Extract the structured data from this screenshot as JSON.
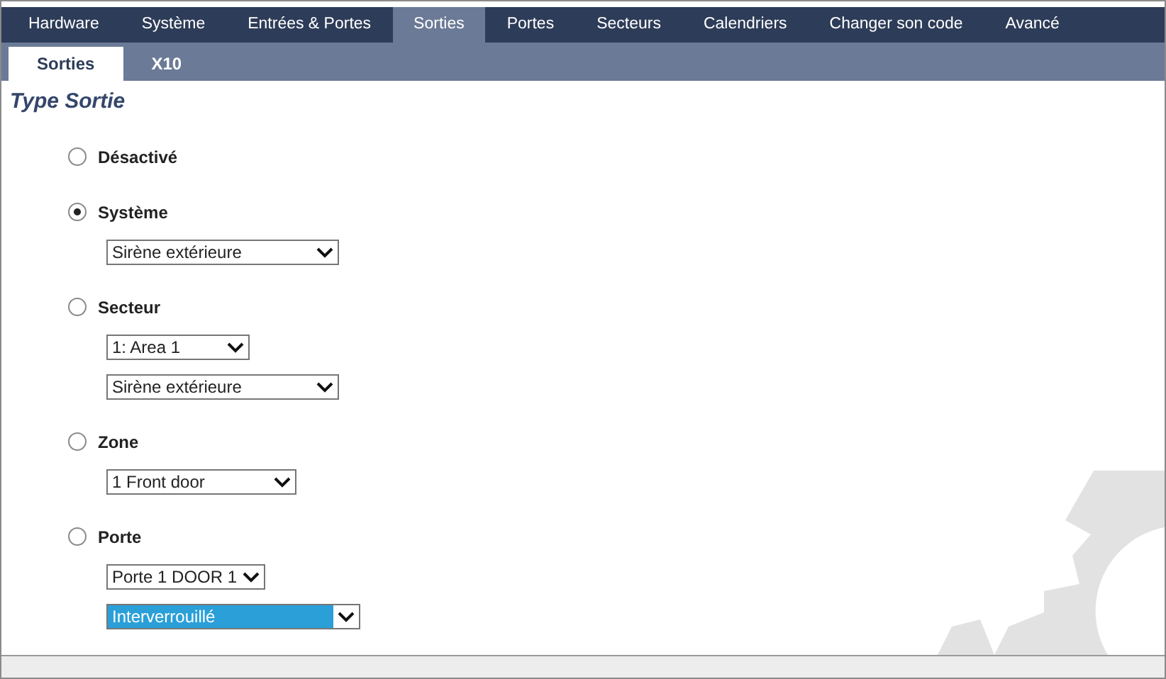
{
  "main_tabs": [
    {
      "label": "Hardware",
      "selected": false
    },
    {
      "label": "Système",
      "selected": false
    },
    {
      "label": "Entrées & Portes",
      "selected": false
    },
    {
      "label": "Sorties",
      "selected": true
    },
    {
      "label": "Portes",
      "selected": false
    },
    {
      "label": "Secteurs",
      "selected": false
    },
    {
      "label": "Calendriers",
      "selected": false
    },
    {
      "label": "Changer son code",
      "selected": false
    },
    {
      "label": "Avancé",
      "selected": false
    }
  ],
  "sub_tabs": [
    {
      "label": "Sorties",
      "selected": true
    },
    {
      "label": "X10",
      "selected": false
    }
  ],
  "section_title": "Type Sortie",
  "options": [
    {
      "label": "Désactivé",
      "selected": false
    },
    {
      "label": "Système",
      "selected": true,
      "dropdowns": [
        {
          "value": "Sirène extérieure",
          "highlighted": false
        }
      ]
    },
    {
      "label": "Secteur",
      "selected": false,
      "dropdowns": [
        {
          "value": "1: Area 1",
          "highlighted": false
        },
        {
          "value": "Sirène extérieure",
          "highlighted": false
        }
      ]
    },
    {
      "label": "Zone",
      "selected": false,
      "dropdowns": [
        {
          "value": "1 Front door",
          "highlighted": false
        }
      ]
    },
    {
      "label": "Porte",
      "selected": false,
      "dropdowns": [
        {
          "value": "Porte 1 DOOR 1",
          "highlighted": false
        },
        {
          "value": "Interverrouillé",
          "highlighted": true
        }
      ]
    }
  ]
}
